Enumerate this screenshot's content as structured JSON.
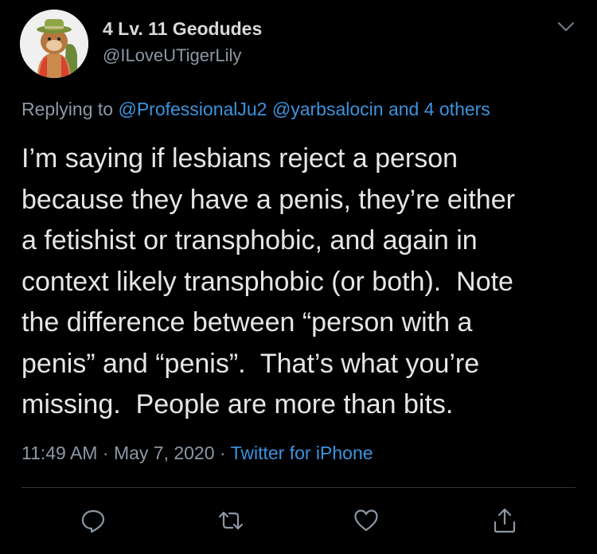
{
  "author": {
    "display_name": "4 Lv. 11 Geodudes",
    "handle": "@ILoveUTigerLily"
  },
  "reply": {
    "prefix": "Replying to",
    "mention1": "@ProfessionalJu2",
    "mention2": "@yarbsalocin",
    "others": "and 4 others"
  },
  "tweet": {
    "lines": [
      "I’m saying if lesbians reject a person",
      "because they have a penis, they’re either",
      "a fetishist or transphobic, and again in",
      "context likely transphobic (or both).  Note",
      "the difference between “person with a",
      "penis” and “penis”.  That’s what you’re",
      "missing.  People are more than bits."
    ]
  },
  "meta": {
    "time": "11:49 AM",
    "separator": "·",
    "date": "May 7, 2020",
    "source": "Twitter for iPhone"
  },
  "colors": {
    "background": "#000000",
    "text": "#e6e6e6",
    "muted": "#8b98a5",
    "link": "#3c93de",
    "divider": "#2f3336"
  },
  "icons": [
    "avatar",
    "chevron-down-icon",
    "reply-icon",
    "retweet-icon",
    "like-icon",
    "share-icon"
  ]
}
